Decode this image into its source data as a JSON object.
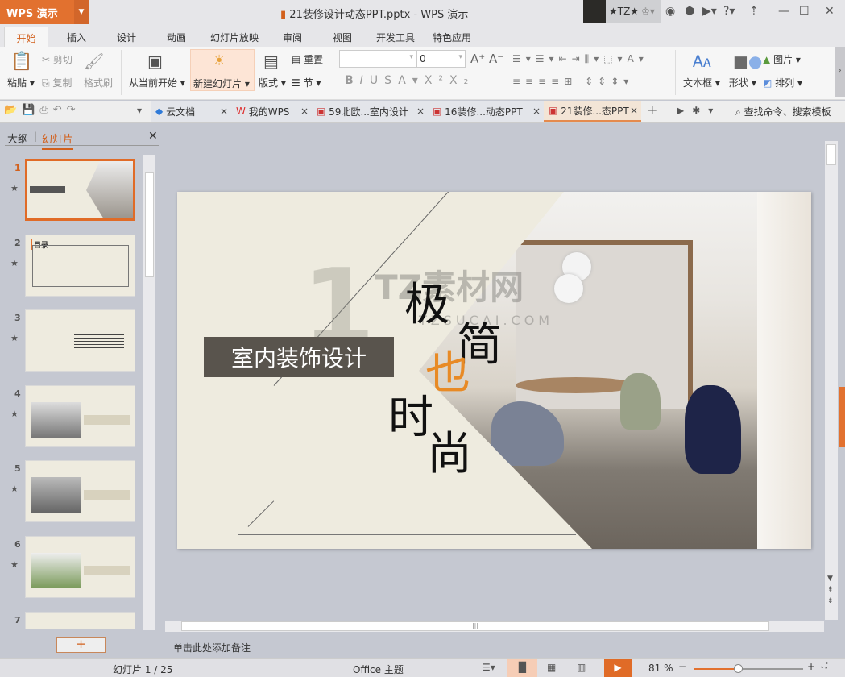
{
  "app": {
    "menu_button": "WPS 演示",
    "title": "21装修设计动态PPT.pptx - WPS 演示",
    "user": "★TZ★"
  },
  "ribbon_tabs": [
    "开始",
    "插入",
    "设计",
    "动画",
    "幻灯片放映",
    "审阅",
    "视图",
    "开发工具",
    "特色应用"
  ],
  "ribbon": {
    "paste": "粘贴",
    "cut": "剪切",
    "copy": "复制",
    "format_painter": "格式刷",
    "from_current": "从当前开始",
    "new_slide": "新建幻灯片",
    "layout": "版式",
    "reset": "重置",
    "section": "节",
    "font_size": "0",
    "textbox": "文本框",
    "shape": "形状",
    "picture": "图片",
    "arrange": "排列"
  },
  "doc_tabs": [
    {
      "label": "云文档"
    },
    {
      "label": "我的WPS"
    },
    {
      "label": "59北欧...室内设计"
    },
    {
      "label": "16装修...动态PPT"
    },
    {
      "label": "21装修...态PPT"
    }
  ],
  "search_placeholder": "查找命令、搜索模板",
  "panel": {
    "outline_tab": "大纲",
    "slides_tab": "幻灯片",
    "slide_numbers": [
      "1",
      "2",
      "3",
      "4",
      "5",
      "6",
      "7"
    ]
  },
  "slide": {
    "title": "室内装饰设计",
    "line1": "极",
    "line2": "简",
    "mid": "也",
    "line3": "时",
    "line4": "尚",
    "watermark": "TZ素材网",
    "watermark_url": "TZSUCAI.COM"
  },
  "thumb2_title": "目录",
  "notes_placeholder": "单击此处添加备注",
  "status": {
    "slide_count": "幻灯片 1 / 25",
    "theme": "Office 主题",
    "zoom": "81 %",
    "zoom_fraction": 0.4
  },
  "colors": {
    "accent": "#e2712f",
    "slide_bg": "#eeebdf"
  }
}
